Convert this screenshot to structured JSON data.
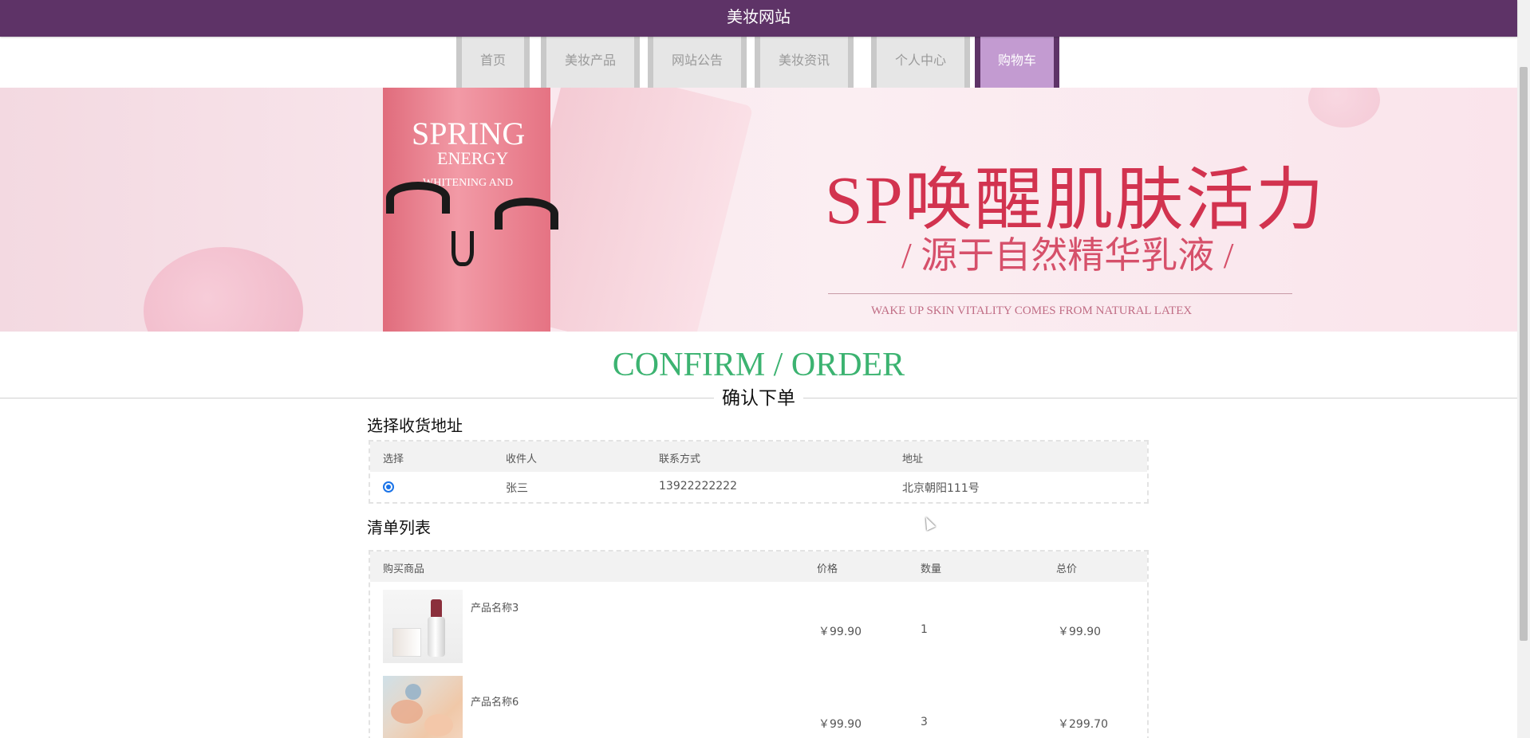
{
  "site": {
    "title": "美妆网站"
  },
  "nav": {
    "items": [
      {
        "label": "首页",
        "active": false
      },
      {
        "label": "美妆产品",
        "active": false
      },
      {
        "label": "网站公告",
        "active": false
      },
      {
        "label": "美妆资讯",
        "active": false
      },
      {
        "label": "个人中心",
        "active": false
      },
      {
        "label": "购物车",
        "active": true
      }
    ]
  },
  "banner": {
    "title": "SP唤醒肌肤活力",
    "subtitle": "/ 源于自然精华乳液 /",
    "english": "WAKE UP SKIN VITALITY COMES FROM NATURAL LATEX",
    "tube_text_1": "SPRING",
    "tube_text_2": "ENERGY",
    "tube_text_3": "WHITENING AND"
  },
  "heading": {
    "en": "CONFIRM / ORDER",
    "cn": "确认下单"
  },
  "address": {
    "section_title": "选择收货地址",
    "headers": [
      "选择",
      "收件人",
      "联系方式",
      "地址"
    ],
    "rows": [
      {
        "selected": true,
        "recipient": "张三",
        "phone": "13922222222",
        "address": "北京朝阳111号"
      }
    ]
  },
  "cart": {
    "section_title": "清单列表",
    "headers": [
      "购买商品",
      "价格",
      "数量",
      "总价"
    ],
    "rows": [
      {
        "name": "产品名称3",
        "price": "￥99.90",
        "qty": "1",
        "total": "￥99.90"
      },
      {
        "name": "产品名称6",
        "price": "￥99.90",
        "qty": "3",
        "total": "￥299.70"
      }
    ]
  }
}
